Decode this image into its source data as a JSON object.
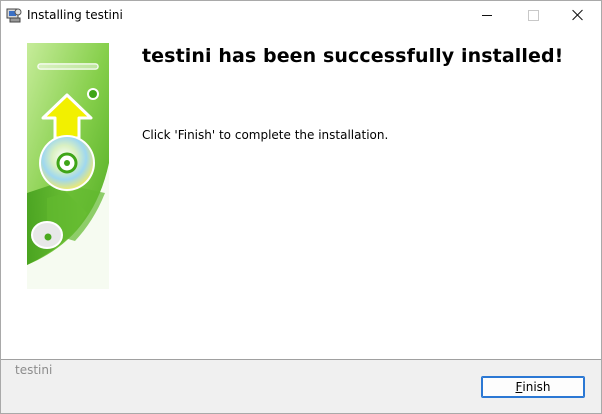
{
  "window": {
    "title": "Installing testini",
    "icon": "installer-icon",
    "controls": {
      "minimize": "minimize-icon",
      "maximize": "maximize-icon",
      "close": "close-icon"
    }
  },
  "main": {
    "heading": "testini has been successfully installed!",
    "message": "Click 'Finish' to complete the installation.",
    "banner_icon": "install-cd-banner"
  },
  "footer": {
    "branding": "testini",
    "finish_label_first": "F",
    "finish_label_rest": "inish"
  },
  "colors": {
    "banner_green": "#5bb82a",
    "banner_light": "#a9dc7e",
    "arrow_yellow": "#f4f000",
    "accent_blue": "#2b78d4"
  }
}
